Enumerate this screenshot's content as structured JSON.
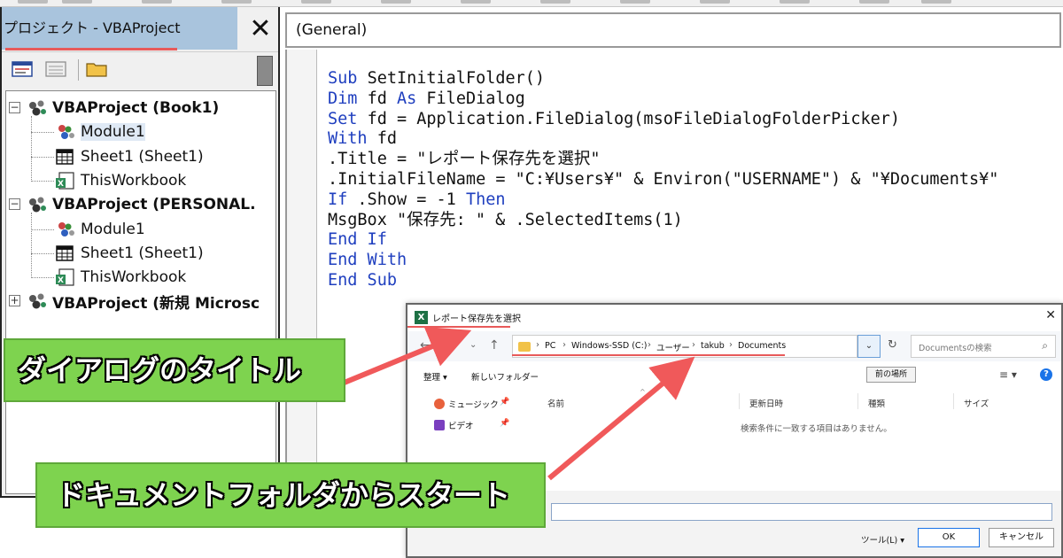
{
  "project_explorer": {
    "title": "プロジェクト - VBAProject",
    "close_label": "✕",
    "tree": [
      {
        "label": "VBAProject (Book1)",
        "level": 0,
        "expander": "−",
        "kind": "project"
      },
      {
        "label": "Module1",
        "level": 1,
        "kind": "module",
        "selected": true
      },
      {
        "label": "Sheet1 (Sheet1)",
        "level": 1,
        "kind": "sheet"
      },
      {
        "label": "ThisWorkbook",
        "level": 1,
        "kind": "workbook"
      },
      {
        "label": "VBAProject (PERSONAL.",
        "level": 0,
        "expander": "−",
        "kind": "project"
      },
      {
        "label": "Module1",
        "level": 1,
        "kind": "module"
      },
      {
        "label": "Sheet1 (Sheet1)",
        "level": 1,
        "kind": "sheet"
      },
      {
        "label": "ThisWorkbook",
        "level": 1,
        "kind": "workbook"
      },
      {
        "label": "VBAProject (新規 Microsc",
        "level": 0,
        "expander": "+",
        "kind": "project"
      }
    ]
  },
  "code_window": {
    "object_combo": "(General)",
    "lines": [
      [
        {
          "t": "Sub ",
          "k": true
        },
        {
          "t": "SetInitialFolder()"
        }
      ],
      [
        {
          "t": "Dim ",
          "k": true
        },
        {
          "t": "fd "
        },
        {
          "t": "As ",
          "k": true
        },
        {
          "t": "FileDialog"
        }
      ],
      [
        {
          "t": "Set ",
          "k": true
        },
        {
          "t": "fd = Application.FileDialog(msoFileDialogFolderPicker)"
        }
      ],
      [
        {
          "t": "With ",
          "k": true
        },
        {
          "t": "fd"
        }
      ],
      [
        {
          "t": ".Title = \"レポート保存先を選択\""
        }
      ],
      [
        {
          "t": ".InitialFileName = \"C:¥Users¥\" & Environ(\"USERNAME\") & \"¥Documents¥\""
        }
      ],
      [
        {
          "t": "If ",
          "k": true
        },
        {
          "t": ".Show = -1 "
        },
        {
          "t": "Then",
          "k": true
        }
      ],
      [
        {
          "t": "MsgBox \"保存先: \" & .SelectedItems(1)"
        }
      ],
      [
        {
          "t": "End If",
          "k": true
        }
      ],
      [
        {
          "t": "End With",
          "k": true
        }
      ],
      [
        {
          "t": "End Sub",
          "k": true
        }
      ]
    ]
  },
  "dialog": {
    "app_icon": "X",
    "title": "レポート保存先を選択",
    "close_label": "✕",
    "breadcrumb": [
      "PC",
      "Windows-SSD (C:)",
      "ユーザー",
      "takub",
      "Documents"
    ],
    "search_placeholder": "Documentsの検索",
    "toolbar": {
      "organize": "整理 ▾",
      "new_folder": "新しいフォルダー",
      "prev_location": "前の場所"
    },
    "nav_items": [
      "ミュージック",
      "ビデオ"
    ],
    "columns": [
      "名前",
      "更新日時",
      "種類",
      "サイズ"
    ],
    "empty_message": "検索条件に一致する項目はありません。",
    "filename_label": ":",
    "tools_label": "ツール(L) ▾",
    "ok_label": "OK",
    "cancel_label": "キャンセル"
  },
  "callouts": {
    "title_note": "ダイアログのタイトル",
    "docs_note": "ドキュメントフォルダからスタート"
  },
  "colors": {
    "keyword": "#1f3fbf",
    "callout_green": "#7ed34f",
    "annotation_red": "#e85a5a",
    "explorer_title_bg": "#a9c4dd"
  }
}
